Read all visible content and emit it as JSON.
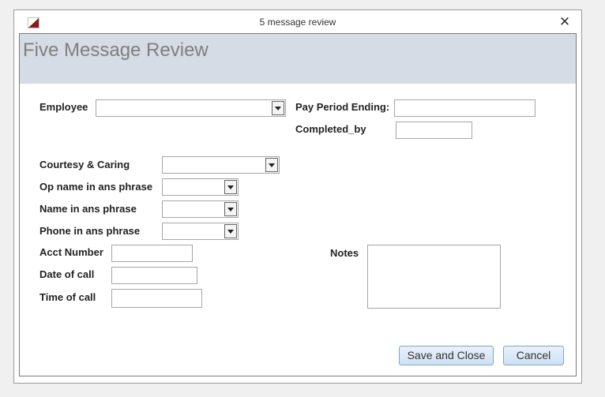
{
  "window": {
    "title": "5 message review",
    "close_glyph": "✕"
  },
  "form": {
    "header_title": "Five Message Review",
    "fields": {
      "employee": {
        "label": "Employee",
        "value": ""
      },
      "pay_period_ending": {
        "label": "Pay Period Ending:",
        "value": ""
      },
      "completed_by": {
        "label": "Completed_by",
        "value": ""
      },
      "courtesy_caring": {
        "label": "Courtesy & Caring",
        "value": ""
      },
      "op_name": {
        "label": "Op name in ans phrase",
        "value": ""
      },
      "name_in_ans": {
        "label": "Name in ans phrase",
        "value": ""
      },
      "phone_in_ans": {
        "label": "Phone in ans phrase",
        "value": ""
      },
      "acct_number": {
        "label": "Acct Number",
        "value": ""
      },
      "date_of_call": {
        "label": "Date of call",
        "value": ""
      },
      "time_of_call": {
        "label": "Time of call",
        "value": ""
      },
      "notes": {
        "label": "Notes",
        "value": ""
      }
    },
    "buttons": {
      "save_close": "Save and Close",
      "cancel": "Cancel"
    }
  },
  "colors": {
    "header_bg": "#d6dce5",
    "button_border": "#7ea6d4",
    "icon_accent": "#8b1a1a"
  }
}
